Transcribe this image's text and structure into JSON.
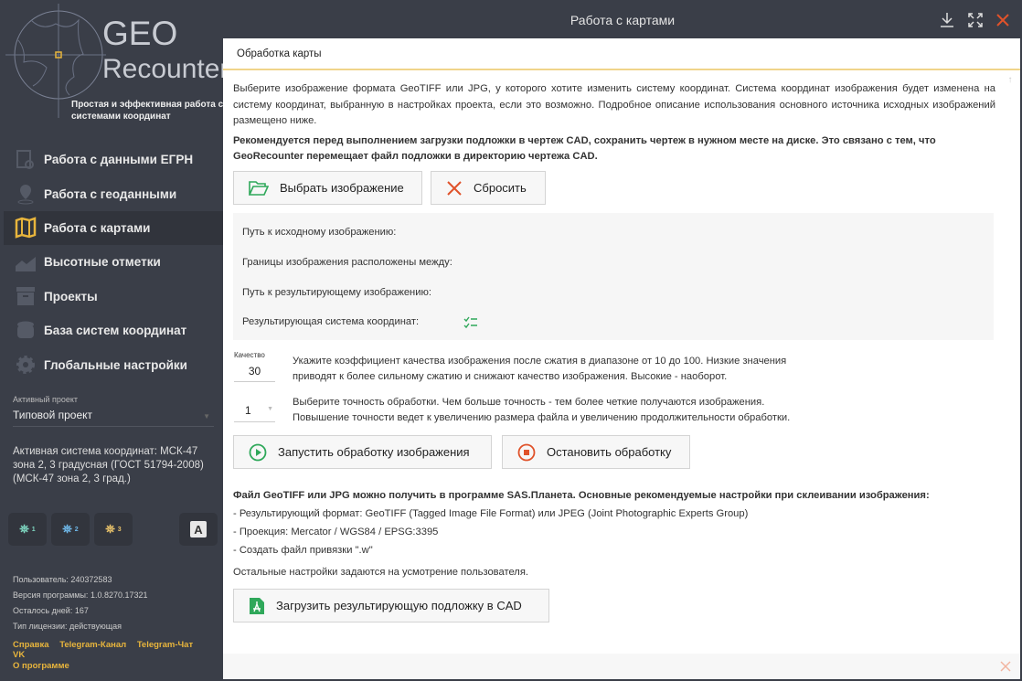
{
  "logo": {
    "title1": "GEO",
    "title2": "Recounter",
    "tagline": "Простая и эффективная работа с системами координат"
  },
  "nav": [
    {
      "label": "Работа с данными ЕГРН",
      "icon": "document-search-icon"
    },
    {
      "label": "Работа с геоданными",
      "icon": "location-pin-icon"
    },
    {
      "label": "Работа с картами",
      "icon": "map-icon",
      "active": true
    },
    {
      "label": "Высотные отметки",
      "icon": "elevation-chart-icon"
    },
    {
      "label": "Проекты",
      "icon": "archive-box-icon"
    },
    {
      "label": "База систем координат",
      "icon": "database-icon"
    },
    {
      "label": "Глобальные настройки",
      "icon": "gear-icon"
    }
  ],
  "project": {
    "label": "Активный проект",
    "value": "Типовой проект"
  },
  "coord_system": "Активная система координат: МСК-47 зона 2, 3 градусная (ГОСТ 51794-2008) (МСК-47 зона 2, 3 град.)",
  "tools": [
    "1",
    "2",
    "3"
  ],
  "info": {
    "user": "Пользователь: 240372583",
    "version": "Версия программы: 1.0.8270.17321",
    "days": "Осталось дней: 167",
    "license": "Тип лицензии: действующая"
  },
  "links": [
    "Справка",
    "Telegram-Канал",
    "Telegram-Чат",
    "VK"
  ],
  "about": "О программе",
  "window_title": "Работа с картами",
  "tab": "Обработка карты",
  "intro": "Выберите изображение формата GeoTIFF или JPG, у которого хотите изменить систему координат. Система координат изображения будет изменена на систему координат, выбранную в настройках проекта, если это возможно. Подробное описание использования основного источника исходных изображений размещено ниже.",
  "recommend": "Рекомендуется перед выполнением загрузки подложки в чертеж CAD, сохранить чертеж в нужном месте на диске. Это связано с тем, что GeoRecounter перемещает файл подложки в директорию чертежа CAD.",
  "buttons": {
    "select": "Выбрать изображение",
    "reset": "Сбросить",
    "run": "Запустить обработку изображения",
    "stop": "Остановить обработку",
    "load": "Загрузить результирующую подложку в CAD"
  },
  "panel": {
    "source": "Путь к исходному изображению:",
    "bounds": "Границы изображения расположены между:",
    "result": "Путь к результирующему изображению:",
    "crs": "Результирующая система координат:"
  },
  "quality": {
    "label": "Качество",
    "value": "30",
    "help1": "Укажите коэффициент качества изображения после сжатия в диапазоне от 10 до 100. Низкие значения",
    "help2": "приводят к более сильному сжатию и снижают качество изображения. Высокие - наоборот."
  },
  "precision": {
    "value": "1",
    "help1": "Выберите точность обработки. Чем больше точность - тем более четкие получаются изображения.",
    "help2": "Повышение точности ведет к увеличению размера файла и увеличению продолжительности обработки."
  },
  "sas": {
    "title": "Файл GeoTIFF или JPG можно получить в программе SAS.Планета. Основные рекомендуемые настройки при склеивании изображения:",
    "l1": "- Результирующий формат: GeoTIFF (Tagged Image File Format) или JPEG (Joint Photographic Experts Group)",
    "l2": "- Проекция: Mercator / WGS84 / EPSG:3395",
    "l3": "- Создать файл привязки \".w\"",
    "rest": "Остальные настройки задаются на усмотрение пользователя."
  }
}
